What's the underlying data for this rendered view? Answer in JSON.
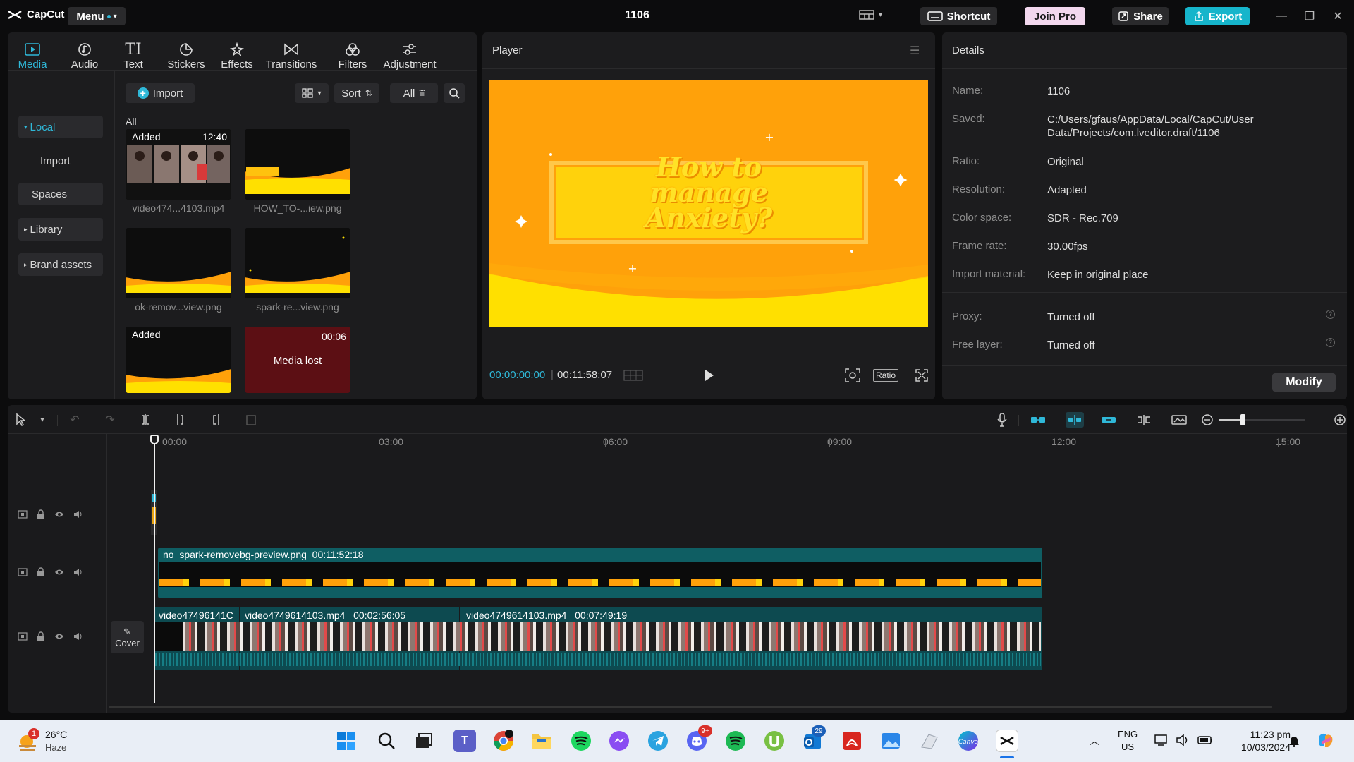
{
  "app": {
    "name": "CapCut",
    "menu_label": "Menu",
    "project_title": "1106"
  },
  "titlebar": {
    "shortcut_label": "Shortcut",
    "join_pro_label": "Join Pro",
    "share_label": "Share",
    "export_label": "Export"
  },
  "tools": [
    "Media",
    "Audio",
    "Text",
    "Stickers",
    "Effects",
    "Transitions",
    "Filters",
    "Adjustment"
  ],
  "sidebar": {
    "items": [
      {
        "label": "Local",
        "caret": "▾"
      },
      {
        "label": "Import"
      },
      {
        "label": "Spaces"
      },
      {
        "label": "Library",
        "caret": "▸"
      },
      {
        "label": "Brand assets",
        "caret": "▸"
      }
    ]
  },
  "media": {
    "import_label": "Import",
    "sort_label": "Sort",
    "all_label": "All",
    "section_label": "All",
    "items": [
      {
        "name": "video474...4103.mp4",
        "badge": "Added",
        "duration": "12:40"
      },
      {
        "name": "HOW_TO-...iew.png"
      },
      {
        "name": "ok-remov...view.png"
      },
      {
        "name": "spark-re...view.png"
      },
      {
        "badge": "Added"
      },
      {
        "duration": "00:06",
        "status": "Media lost"
      }
    ]
  },
  "player": {
    "title": "Player",
    "current_time": "00:00:00:00",
    "total_time": "00:11:58:07",
    "ratio_label": "Ratio",
    "canvas_text": [
      "How to",
      "manage",
      "Anxiety?"
    ],
    "colors": {
      "bg": "#ffa10a",
      "band": "#ffe000",
      "text": "#ffe227"
    }
  },
  "details": {
    "title": "Details",
    "rows": [
      {
        "label": "Name:",
        "value": "1106"
      },
      {
        "label": "Saved:",
        "value": "C:/Users/gfaus/AppData/Local/CapCut/User Data/Projects/com.lveditor.draft/1106"
      },
      {
        "label": "Ratio:",
        "value": "Original"
      },
      {
        "label": "Resolution:",
        "value": "Adapted"
      },
      {
        "label": "Color space:",
        "value": "SDR - Rec.709"
      },
      {
        "label": "Frame rate:",
        "value": "30.00fps"
      },
      {
        "label": "Import material:",
        "value": "Keep in original place"
      },
      {
        "label": "Proxy:",
        "value": "Turned off"
      },
      {
        "label": "Free layer:",
        "value": "Turned off"
      }
    ],
    "modify_label": "Modify"
  },
  "timeline": {
    "ruler": [
      "00:00",
      "03:00",
      "06:00",
      "09:00",
      "12:00",
      "15:00"
    ],
    "cover_label": "Cover",
    "track_sticker": {
      "name": "no_spark-removebg-preview.png",
      "duration": "00:11:52:18"
    },
    "track_main": [
      {
        "name": "video47496141C"
      },
      {
        "name": "video4749614103.mp4",
        "duration": "00:02:56:05"
      },
      {
        "name": "video4749614103.mp4",
        "duration": "00:07:49:19"
      }
    ]
  },
  "taskbar": {
    "weather_temp": "26°C",
    "weather_desc": "Haze",
    "weather_badge": "1",
    "lang_top": "ENG",
    "lang_bottom": "US",
    "time": "11:23 pm",
    "date": "10/03/2024",
    "discord_badge": "9+",
    "outlook_badge": "29"
  },
  "accent": "#2fb8d8"
}
